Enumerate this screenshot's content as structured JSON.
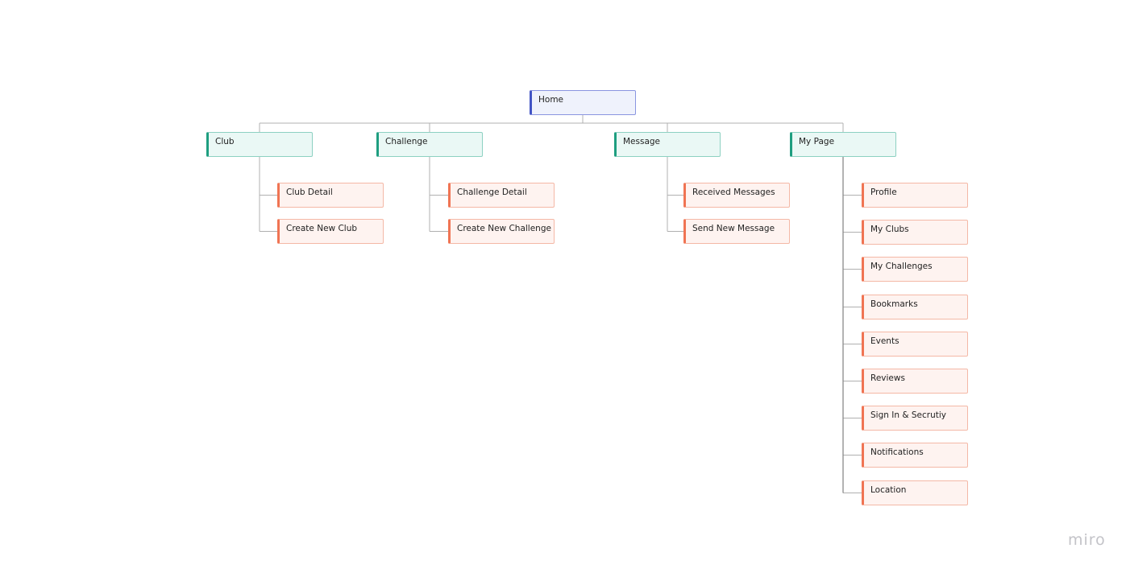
{
  "root": {
    "label": "Home"
  },
  "branches": [
    {
      "label": "Club",
      "children": [
        "Club Detail",
        "Create New Club"
      ]
    },
    {
      "label": "Challenge",
      "children": [
        "Challenge Detail",
        "Create New Challenge"
      ]
    },
    {
      "label": "Message",
      "children": [
        "Received Messages",
        "Send New Message"
      ]
    },
    {
      "label": "My Page",
      "children": [
        "Profile",
        "My Clubs",
        "My Challenges",
        "Bookmarks",
        "Events",
        "Reviews",
        "Sign In & Secrutiy",
        "Notifications",
        "Location"
      ]
    }
  ],
  "colors": {
    "root": "#4254c5",
    "branch": "#1e9e80",
    "leaf": "#f07453",
    "connector": "#b0b0b0"
  },
  "logo": "miro"
}
